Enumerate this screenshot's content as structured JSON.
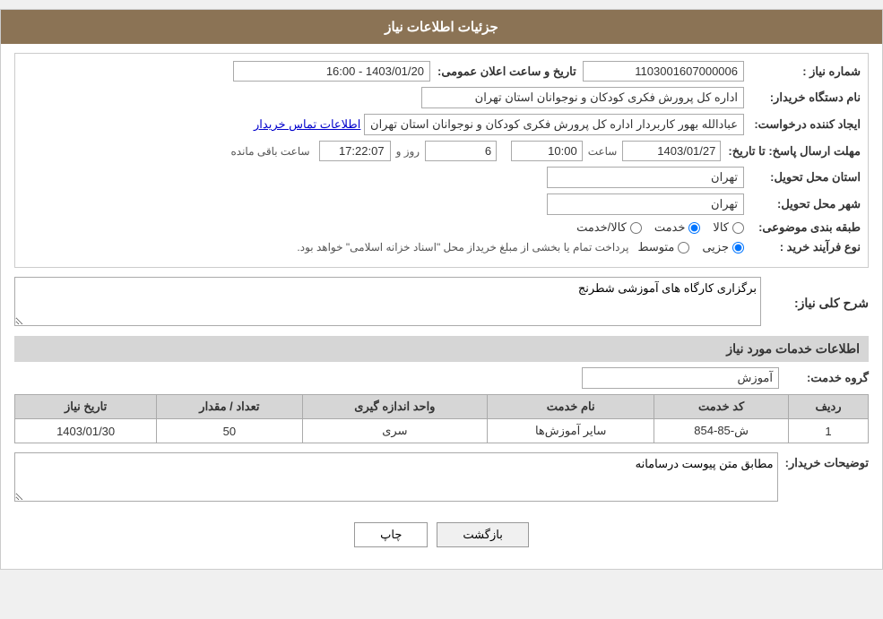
{
  "header": {
    "title": "جزئیات اطلاعات نیاز"
  },
  "fields": {
    "need_number_label": "شماره نیاز :",
    "need_number_value": "1103001607000006",
    "date_label": "تاریخ و ساعت اعلان عمومی:",
    "date_value": "1403/01/20 - 16:00",
    "buyer_name_label": "نام دستگاه خریدار:",
    "buyer_name_value": "اداره کل پرورش فکری کودکان و نوجوانان استان تهران",
    "creator_label": "ایجاد کننده درخواست:",
    "creator_value": "عبادالله بهور کاربردار اداره کل پرورش فکری کودکان و نوجوانان استان تهران",
    "contact_link": "اطلاعات تماس خریدار",
    "deadline_label": "مهلت ارسال پاسخ: تا تاریخ:",
    "deadline_date": "1403/01/27",
    "deadline_time_label": "ساعت",
    "deadline_time": "10:00",
    "deadline_day_label": "روز و",
    "deadline_days": "6",
    "deadline_remaining_label": "ساعت باقی مانده",
    "deadline_remaining_time": "17:22:07",
    "province_label": "استان محل تحویل:",
    "province_value": "تهران",
    "city_label": "شهر محل تحویل:",
    "city_value": "تهران",
    "category_label": "طبقه بندی موضوعی:",
    "radio_kala": "کالا",
    "radio_khadamat": "خدمت",
    "radio_kala_khadamat": "کالا/خدمت",
    "purchase_type_label": "نوع فرآیند خرید :",
    "radio_jozi": "جزیی",
    "radio_motavaset": "متوسط",
    "purchase_process_text": "پرداخت تمام یا بخشی از مبلغ خریداز محل \"اسناد خزانه اسلامی\" خواهد بود.",
    "need_description_label": "شرح کلی نیاز:",
    "need_description_value": "برگزاری کارگاه های آموزشی شطرنج"
  },
  "services_section": {
    "title": "اطلاعات خدمات مورد نیاز",
    "group_label": "گروه خدمت:",
    "group_value": "آموزش",
    "table": {
      "columns": [
        "ردیف",
        "کد خدمت",
        "نام خدمت",
        "واحد اندازه گیری",
        "تعداد / مقدار",
        "تاریخ نیاز"
      ],
      "rows": [
        {
          "row_num": "1",
          "service_code": "ش-85-854",
          "service_name": "سایر آموزش‌ها",
          "unit": "سری",
          "quantity": "50",
          "date": "1403/01/30"
        }
      ]
    }
  },
  "buyer_notes_label": "توضیحات خریدار:",
  "buyer_notes_value": "مطابق متن پیوست درسامانه",
  "buttons": {
    "print": "چاپ",
    "back": "بازگشت"
  }
}
